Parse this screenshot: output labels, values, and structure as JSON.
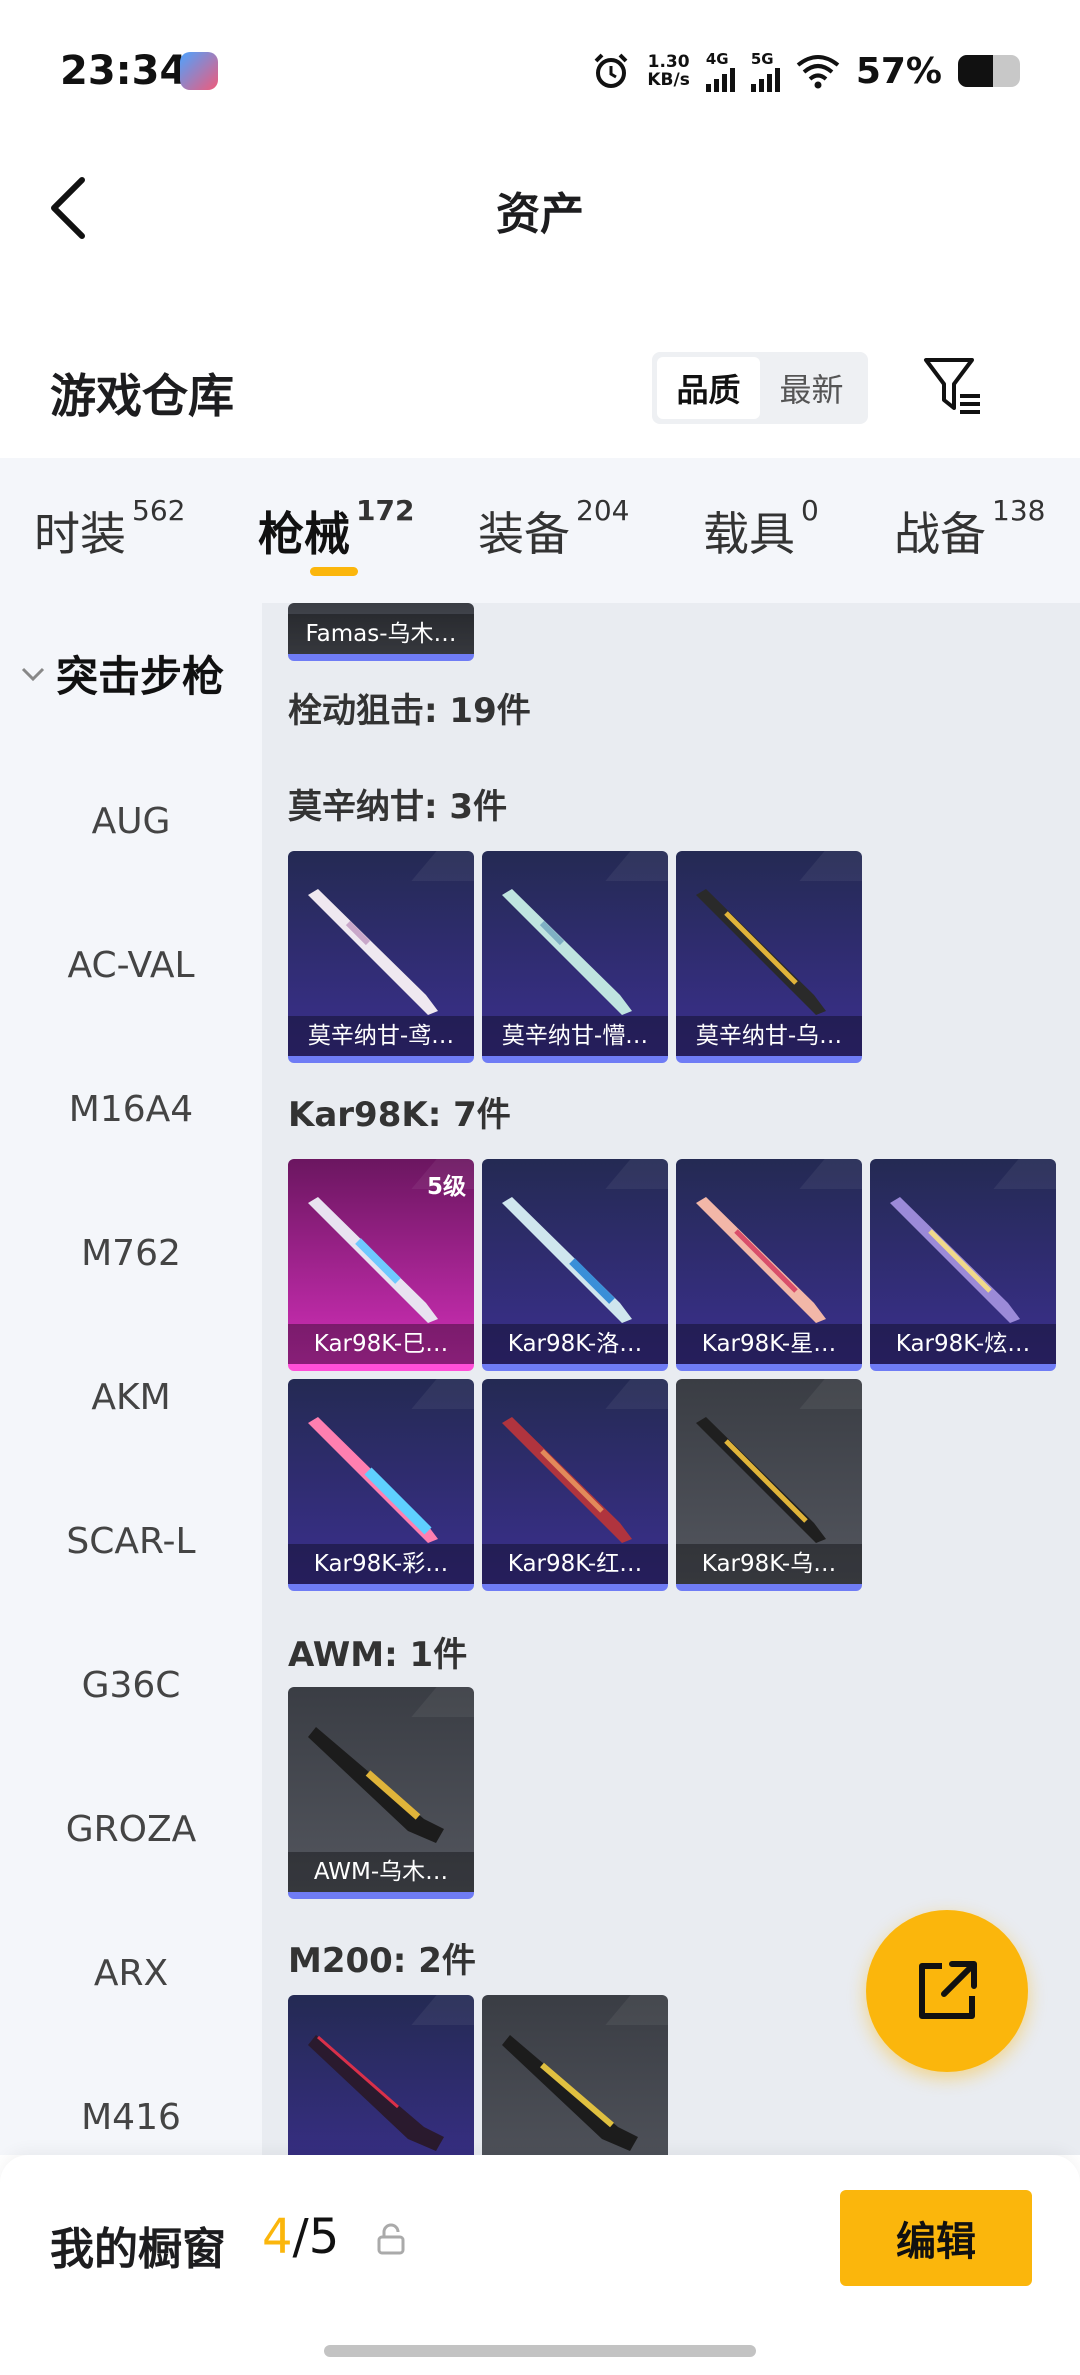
{
  "status_bar": {
    "time": "23:34",
    "speed_value": "1.30",
    "speed_unit": "KB/s",
    "net1": "4G",
    "net2": "5G",
    "battery_text": "57%",
    "battery_level": 0.57,
    "icons": [
      "app-icon",
      "alarm-icon",
      "signal-icon",
      "wifi-icon",
      "battery-icon"
    ]
  },
  "header": {
    "title": "资产",
    "back_icon": "chevron-left-icon"
  },
  "warehouse": {
    "title": "游戏仓库",
    "sort_options": [
      "品质",
      "最新"
    ],
    "sort_active": "品质",
    "filter_icon": "filter-icon"
  },
  "tabs": [
    {
      "label": "时装",
      "count": "562"
    },
    {
      "label": "枪械",
      "count": "172",
      "active": true
    },
    {
      "label": "装备",
      "count": "204"
    },
    {
      "label": "载具",
      "count": "0"
    },
    {
      "label": "战备",
      "count": "138"
    }
  ],
  "sidebar": {
    "category": "突击步枪",
    "items": [
      "AUG",
      "AC-VAL",
      "M16A4",
      "M762",
      "AKM",
      "SCAR-L",
      "G36C",
      "GROZA",
      "ARX",
      "M416"
    ]
  },
  "content": {
    "top_card": {
      "name": "Famas-乌木…"
    },
    "groups": [
      {
        "label": "栓动狙击: 19件"
      },
      {
        "label": "莫辛纳甘: 3件",
        "items": [
          {
            "name": "莫辛纳甘-鸢…",
            "rarity": "purple"
          },
          {
            "name": "莫辛纳甘-懵…",
            "rarity": "purple"
          },
          {
            "name": "莫辛纳甘-乌…",
            "rarity": "purple"
          }
        ]
      },
      {
        "label": "Kar98K: 7件",
        "items": [
          {
            "name": "Kar98K-巳…",
            "rarity": "pink",
            "level": "5级"
          },
          {
            "name": "Kar98K-洛…",
            "rarity": "purple"
          },
          {
            "name": "Kar98K-星…",
            "rarity": "purple"
          },
          {
            "name": "Kar98K-炫…",
            "rarity": "purple"
          },
          {
            "name": "Kar98K-彩…",
            "rarity": "purple"
          },
          {
            "name": "Kar98K-红…",
            "rarity": "purple"
          },
          {
            "name": "Kar98K-乌…",
            "rarity": "gray"
          }
        ]
      },
      {
        "label": "AWM: 1件",
        "items": [
          {
            "name": "AWM-乌木…",
            "rarity": "gray"
          }
        ]
      },
      {
        "label": "M200: 2件",
        "items": [
          {
            "rarity": "purple"
          },
          {
            "rarity": "gray"
          }
        ]
      }
    ]
  },
  "fab": {
    "icon": "share-icon"
  },
  "bottom_bar": {
    "title": "我的橱窗",
    "count_current": "4",
    "count_sep": "/",
    "count_total": "5",
    "lock_icon": "lock-icon",
    "edit_label": "编辑"
  }
}
